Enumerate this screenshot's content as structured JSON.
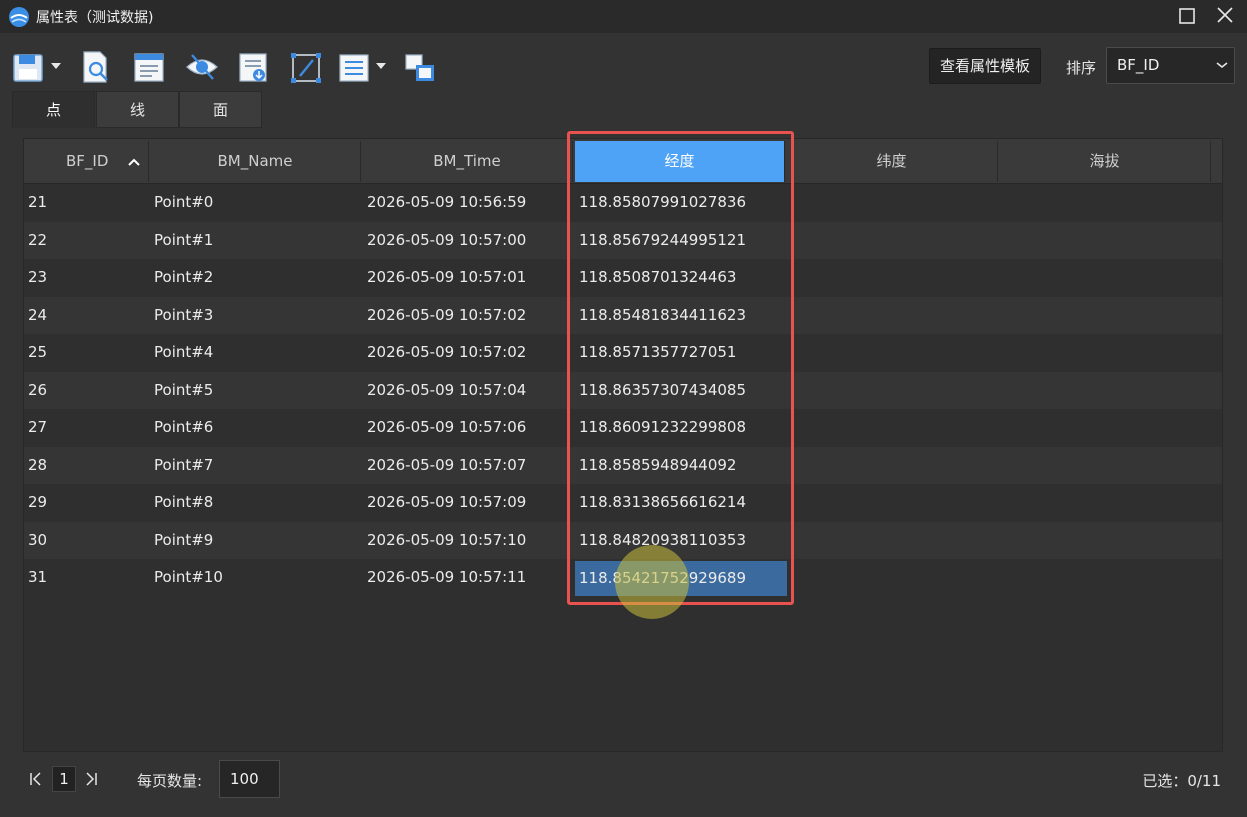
{
  "window": {
    "title": "属性表（测试数据)",
    "maximize_icon": "maximize-icon",
    "close_icon": "close-icon"
  },
  "toolbar": {
    "icons": [
      "save-icon",
      "search-doc-icon",
      "field-doc-icon",
      "hide-icon",
      "export-doc-icon",
      "edit-frame-icon",
      "list-icon",
      "layers-icon"
    ],
    "template_button": "查看属性模板",
    "sort_label": "排序",
    "sort_value": "BF_ID"
  },
  "tabs": [
    {
      "label": "点",
      "active": true
    },
    {
      "label": "线",
      "active": false
    },
    {
      "label": "面",
      "active": false
    }
  ],
  "table": {
    "columns": [
      "BF_ID",
      "BM_Name",
      "BM_Time",
      "经度",
      "纬度",
      "海拔"
    ],
    "selected_column": "经度",
    "rows": [
      {
        "id": "21",
        "name": "Point#0",
        "time": "2026-05-09 10:56:59",
        "lon": "118.85807991027836"
      },
      {
        "id": "22",
        "name": "Point#1",
        "time": "2026-05-09 10:57:00",
        "lon": "118.85679244995121"
      },
      {
        "id": "23",
        "name": "Point#2",
        "time": "2026-05-09 10:57:01",
        "lon": "118.8508701324463"
      },
      {
        "id": "24",
        "name": "Point#3",
        "time": "2026-05-09 10:57:02",
        "lon": "118.85481834411623"
      },
      {
        "id": "25",
        "name": "Point#4",
        "time": "2026-05-09 10:57:02",
        "lon": "118.8571357727051"
      },
      {
        "id": "26",
        "name": "Point#5",
        "time": "2026-05-09 10:57:04",
        "lon": "118.86357307434085"
      },
      {
        "id": "27",
        "name": "Point#6",
        "time": "2026-05-09 10:57:06",
        "lon": "118.86091232299808"
      },
      {
        "id": "28",
        "name": "Point#7",
        "time": "2026-05-09 10:57:07",
        "lon": "118.8585948944092"
      },
      {
        "id": "29",
        "name": "Point#8",
        "time": "2026-05-09 10:57:09",
        "lon": "118.83138656616214"
      },
      {
        "id": "30",
        "name": "Point#9",
        "time": "2026-05-09 10:57:10",
        "lon": "118.84820938110353"
      },
      {
        "id": "31",
        "name": "Point#10",
        "time": "2026-05-09 10:57:11",
        "lon": "118.85421752929689"
      }
    ],
    "selected_row_index": 10
  },
  "footer": {
    "page": "1",
    "page_size_label": "每页数量:",
    "page_size": "100",
    "selected_count": "已选：0/11"
  },
  "colors": {
    "accent": "#4fa3f7",
    "selection": "#3b6a9e",
    "highlight_border": "#e9534f"
  }
}
